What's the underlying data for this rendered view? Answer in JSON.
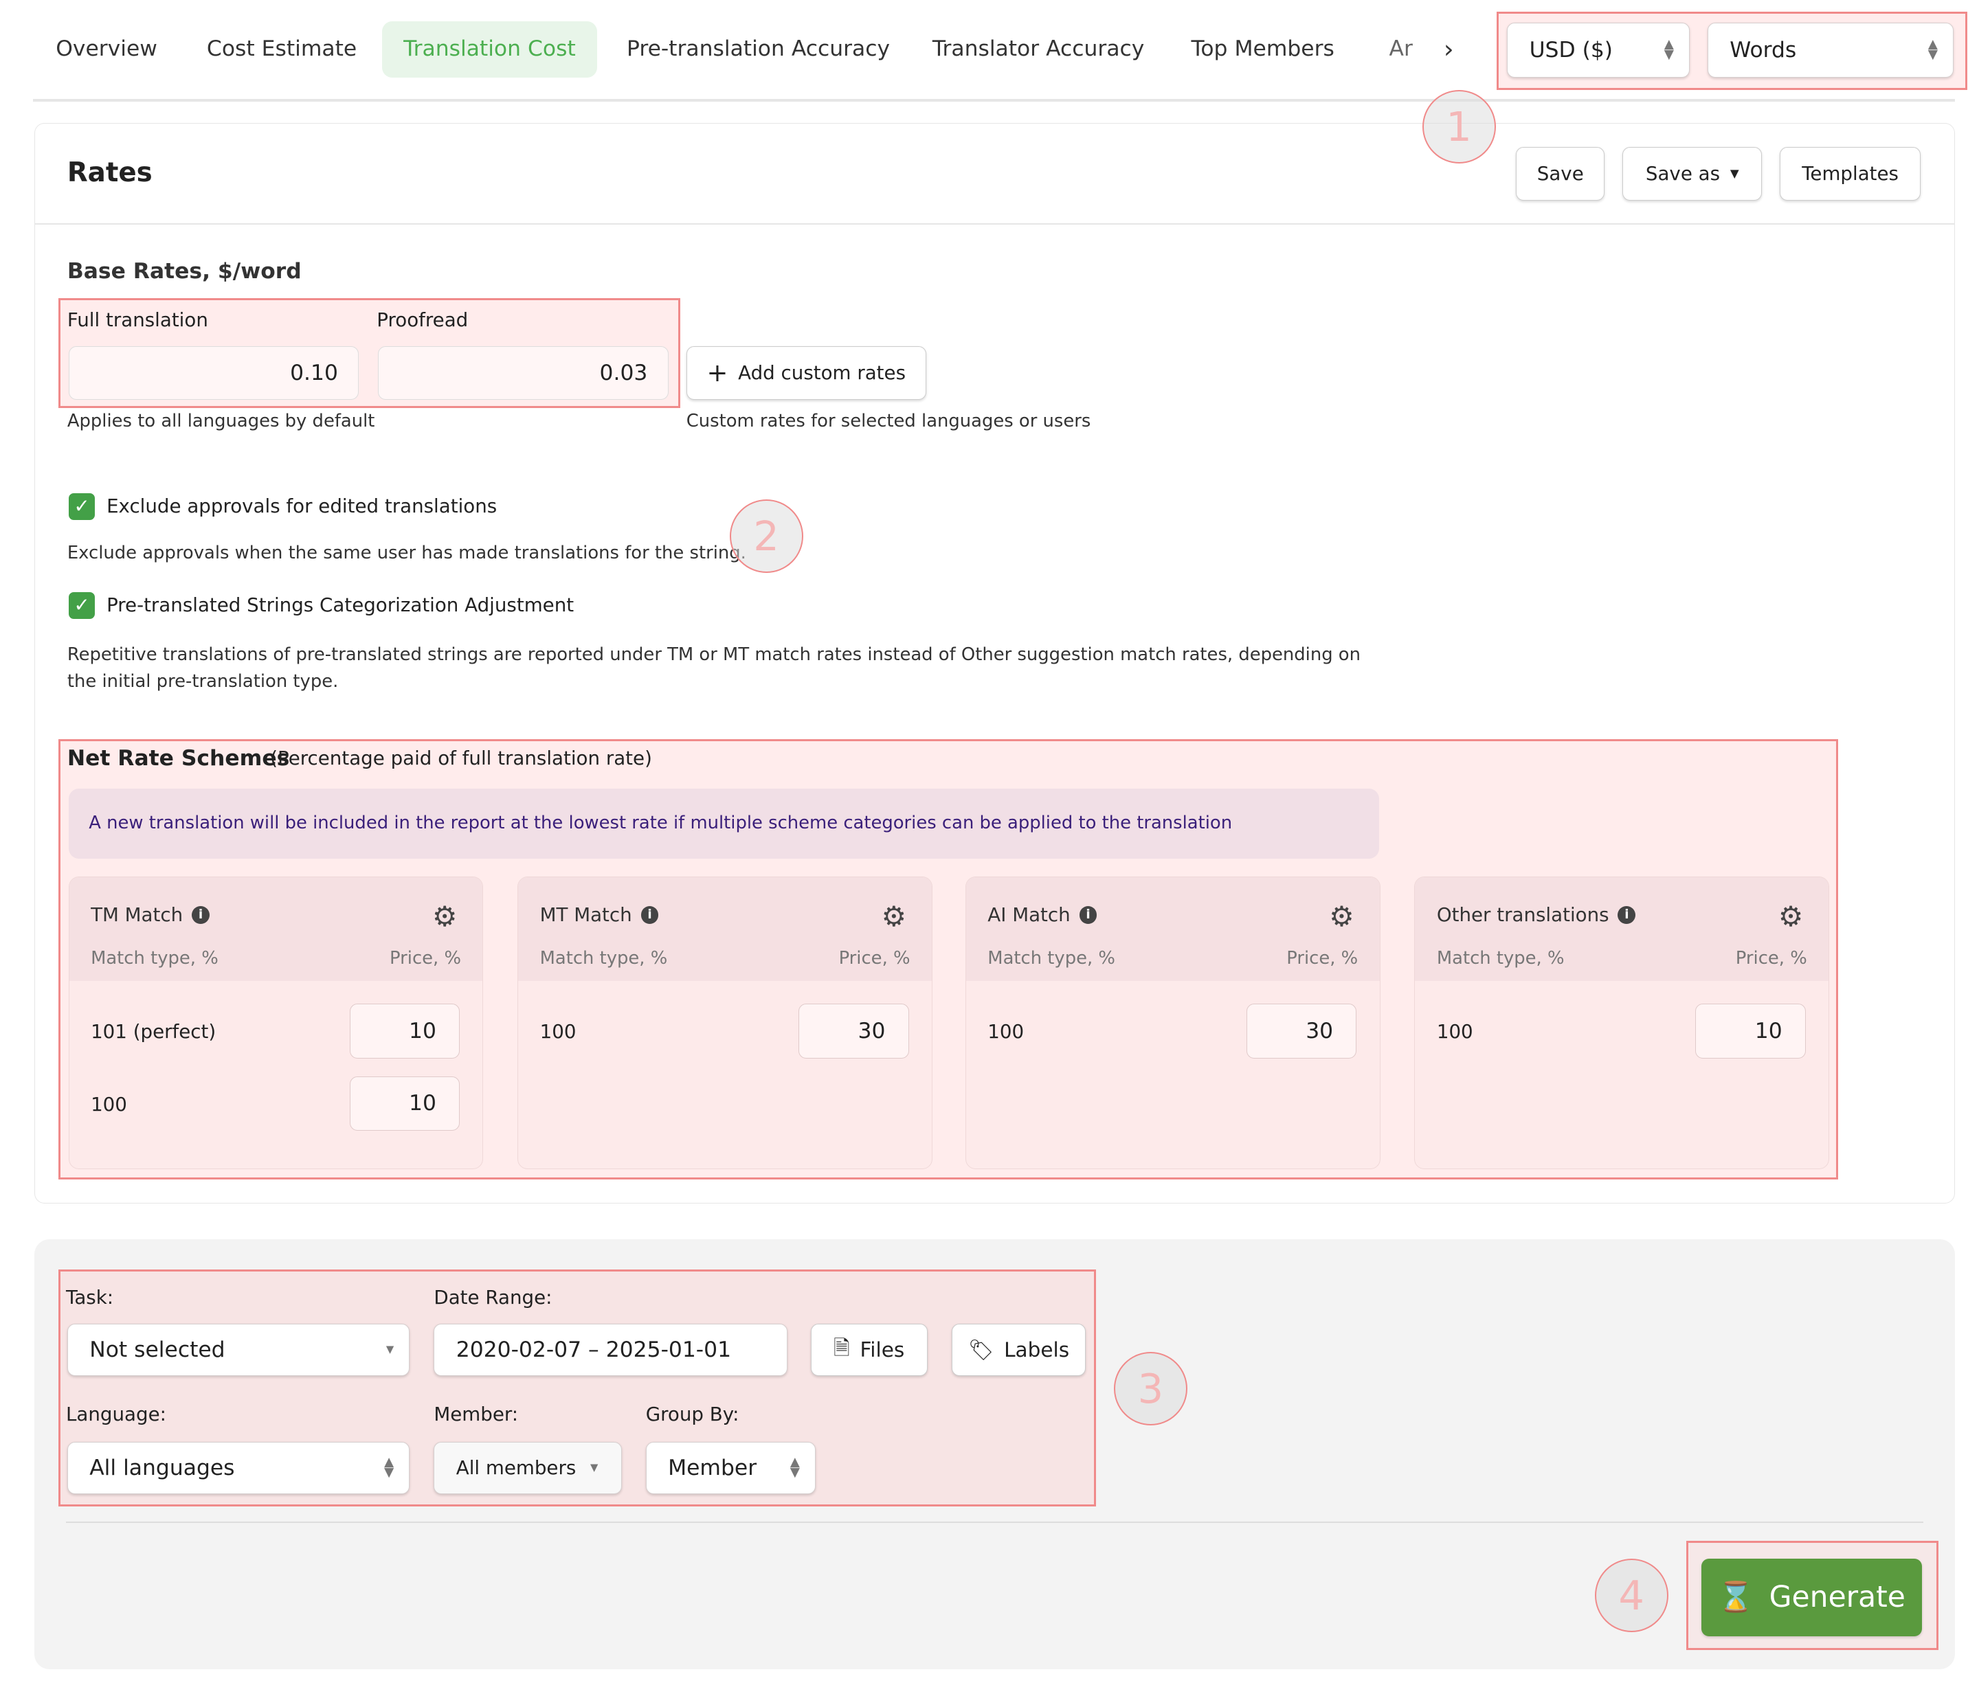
{
  "tabs": [
    {
      "label": "Overview"
    },
    {
      "label": "Cost Estimate"
    },
    {
      "label": "Translation Cost",
      "active": true
    },
    {
      "label": "Pre-translation Accuracy"
    },
    {
      "label": "Translator Accuracy"
    },
    {
      "label": "Top Members"
    },
    {
      "label": "Ar"
    }
  ],
  "currency_select": "USD ($)",
  "unit_select": "Words",
  "annotations": [
    "1",
    "2",
    "3",
    "4"
  ],
  "rates": {
    "title": "Rates",
    "save": "Save",
    "save_as": "Save as",
    "templates": "Templates",
    "base_title": "Base Rates, $/word",
    "full_label": "Full translation",
    "full_value": "0.10",
    "proofread_label": "Proofread",
    "proofread_value": "0.03",
    "base_help": "Applies to all languages by default",
    "add_custom": "Add custom rates",
    "custom_help": "Custom rates for selected languages or users",
    "exclude_label": "Exclude approvals for edited translations",
    "exclude_checked": true,
    "exclude_desc": "Exclude approvals when the same user has made translations for the string.",
    "pretrans_label": "Pre-translated Strings Categorization Adjustment",
    "pretrans_checked": true,
    "pretrans_desc": "Repetitive translations of pre-translated strings are reported under TM or MT match rates instead of Other suggestion match rates, depending on the initial pre-translation type.",
    "net_title": "Net Rate Schemes",
    "net_sub": "(Percentage paid of full translation rate)",
    "net_info": "A new translation will be included in the report at the lowest rate if multiple scheme categories can be applied to the translation",
    "schemes": [
      {
        "title": "TM Match",
        "match_col": "Match type, %",
        "price_col": "Price, %",
        "rows": [
          {
            "match": "101 (perfect)",
            "price": "10"
          },
          {
            "match": "100",
            "price": "10"
          }
        ]
      },
      {
        "title": "MT Match",
        "match_col": "Match type, %",
        "price_col": "Price, %",
        "rows": [
          {
            "match": "100",
            "price": "30"
          }
        ]
      },
      {
        "title": "AI Match",
        "match_col": "Match type, %",
        "price_col": "Price, %",
        "rows": [
          {
            "match": "100",
            "price": "30"
          }
        ]
      },
      {
        "title": "Other translations",
        "match_col": "Match type, %",
        "price_col": "Price, %",
        "rows": [
          {
            "match": "100",
            "price": "10"
          }
        ]
      }
    ]
  },
  "filters": {
    "task_label": "Task:",
    "task_value": "Not selected",
    "date_label": "Date Range:",
    "date_value": "2020-02-07 – 2025-01-01",
    "files": "Files",
    "labels": "Labels",
    "language_label": "Language:",
    "language_value": "All languages",
    "member_label": "Member:",
    "member_value": "All members",
    "group_label": "Group By:",
    "group_value": "Member"
  },
  "generate": "Generate",
  "colors": {
    "accent": "#4caf50",
    "generate": "#5a9a3e",
    "highlight": "#f08a8a"
  }
}
